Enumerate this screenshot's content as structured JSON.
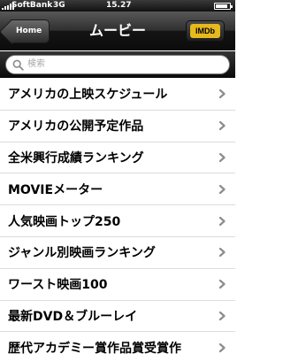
{
  "status_bar": {
    "carrier": "SoftBank",
    "network": "3G",
    "time": "15.27",
    "signal_icon": "signal-bars-icon",
    "battery_icon": "battery-icon",
    "battery_level": 0.85
  },
  "nav": {
    "back_label": "Home",
    "title": "ムービー",
    "imdb_label": "IMDb",
    "imdb_color": "#e6b91e"
  },
  "search": {
    "placeholder": "検索",
    "icon": "search-icon"
  },
  "list": {
    "chevron_icon": "chevron-right-icon",
    "items": [
      {
        "label": "アメリカの上映スケジュール"
      },
      {
        "label": "アメリカの公開予定作品"
      },
      {
        "label": "全米興行成績ランキング"
      },
      {
        "label": "MOVIEメーター"
      },
      {
        "label": "人気映画トップ250"
      },
      {
        "label": "ジャンル別映画ランキング"
      },
      {
        "label": "ワースト映画100"
      },
      {
        "label": "最新DVD＆ブルーレイ"
      },
      {
        "label": "歴代アカデミー賞作品賞受賞作"
      }
    ]
  }
}
